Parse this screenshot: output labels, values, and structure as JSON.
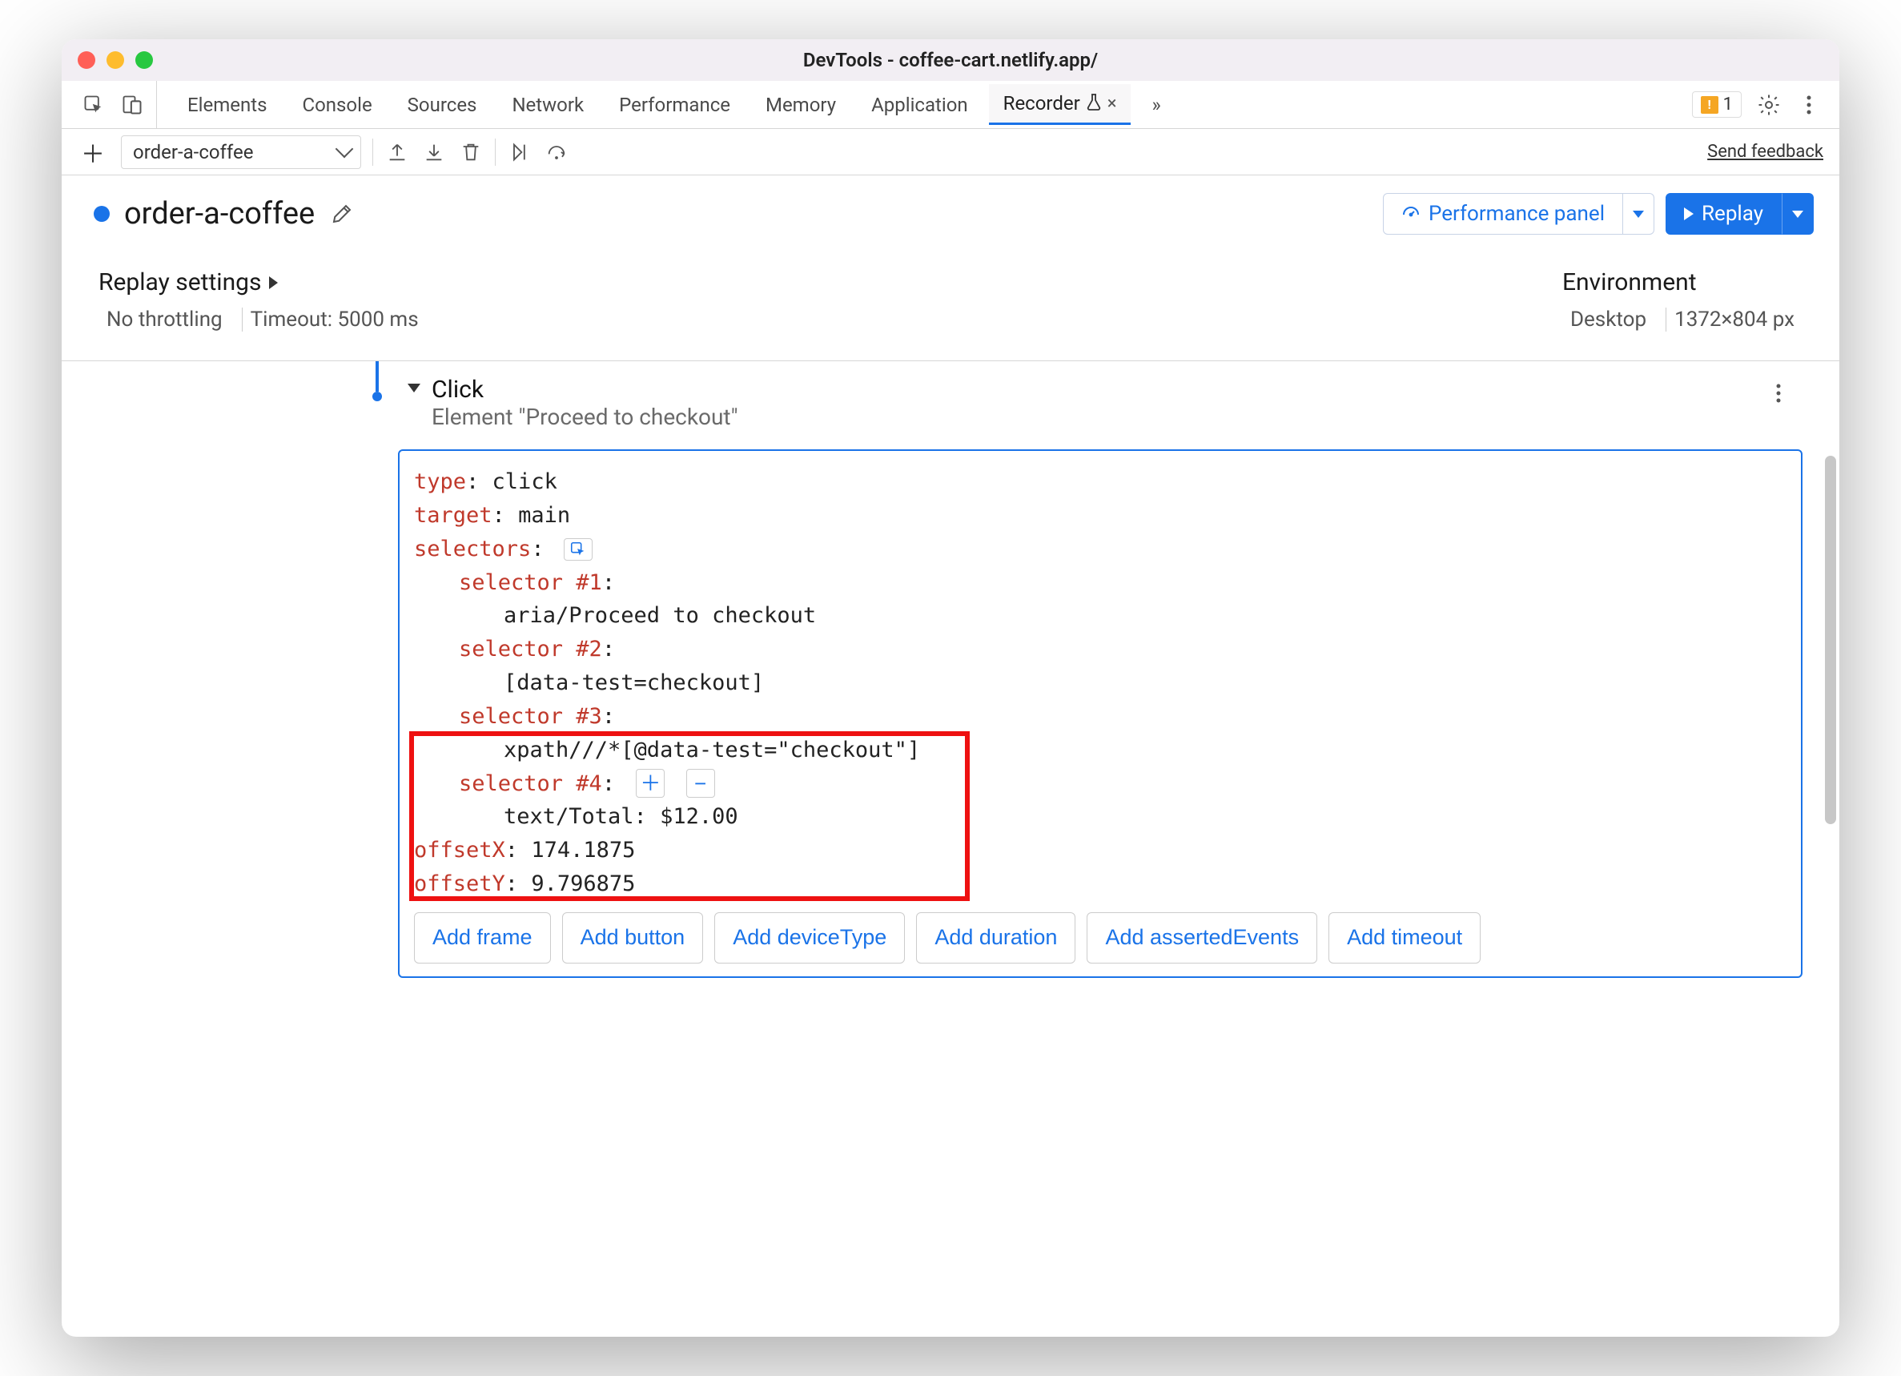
{
  "window_title": "DevTools - coffee-cart.netlify.app/",
  "tabs": [
    "Elements",
    "Console",
    "Sources",
    "Network",
    "Performance",
    "Memory",
    "Application",
    "Recorder"
  ],
  "active_tab_index": 7,
  "warning_count": "1",
  "more_tabs_glyph": "»",
  "recording_name": "order-a-coffee",
  "send_feedback": "Send feedback",
  "header": {
    "title": "order-a-coffee",
    "perf_button": "Performance panel",
    "replay_button": "Replay"
  },
  "replay_settings": {
    "title": "Replay settings",
    "throttling": "No throttling",
    "timeout": "Timeout: 5000 ms"
  },
  "environment": {
    "title": "Environment",
    "device": "Desktop",
    "dimensions": "1372×804 px"
  },
  "step": {
    "name": "Click",
    "subtitle": "Element \"Proceed to checkout\"",
    "type_label": "type",
    "type_value": "click",
    "target_label": "target",
    "target_value": "main",
    "selectors_label": "selectors",
    "selectors": [
      {
        "label": "selector #1",
        "value": "aria/Proceed to checkout"
      },
      {
        "label": "selector #2",
        "value": "[data-test=checkout]"
      },
      {
        "label": "selector #3",
        "value": "xpath///*[@data-test=\"checkout\"]"
      },
      {
        "label": "selector #4",
        "value": "text/Total: $12.00"
      }
    ],
    "offsetX_label": "offsetX",
    "offsetX_value": "174.1875",
    "offsetY_label": "offsetY",
    "offsetY_value": "9.796875",
    "add_buttons": [
      "Add frame",
      "Add button",
      "Add deviceType",
      "Add duration",
      "Add assertedEvents",
      "Add timeout"
    ]
  }
}
